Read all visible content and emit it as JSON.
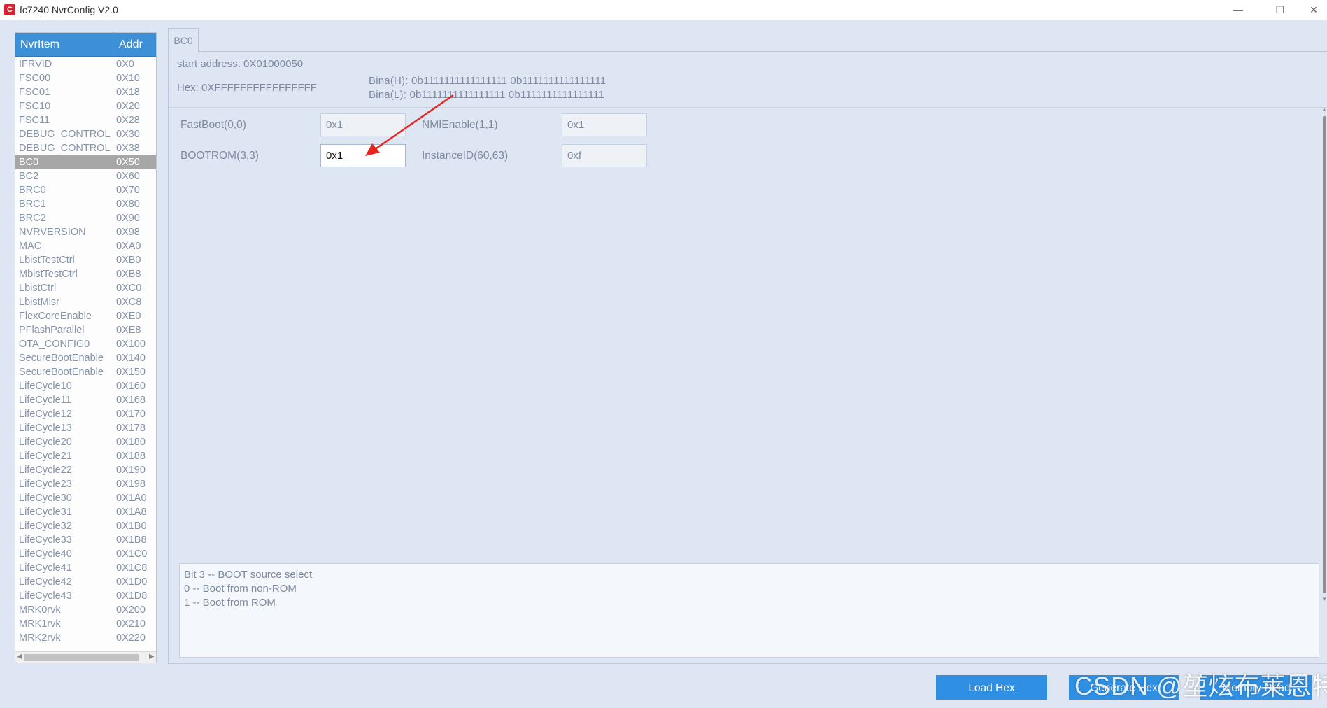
{
  "window": {
    "title": "fc7240 NvrConfig V2.0",
    "icon_text": "C",
    "min_glyph": "—",
    "max_glyph": "❐",
    "close_glyph": "✕"
  },
  "list": {
    "header_name": "NvrItem",
    "header_addr": "Addr",
    "items": [
      {
        "name": "IFRVID",
        "addr": "0X0"
      },
      {
        "name": "FSC00",
        "addr": "0X10"
      },
      {
        "name": "FSC01",
        "addr": "0X18"
      },
      {
        "name": "FSC10",
        "addr": "0X20"
      },
      {
        "name": "FSC11",
        "addr": "0X28"
      },
      {
        "name": "DEBUG_CONTROL",
        "addr": "0X30"
      },
      {
        "name": "DEBUG_CONTROL",
        "addr": "0X38"
      },
      {
        "name": "BC0",
        "addr": "0X50"
      },
      {
        "name": "BC2",
        "addr": "0X60"
      },
      {
        "name": "BRC0",
        "addr": "0X70"
      },
      {
        "name": "BRC1",
        "addr": "0X80"
      },
      {
        "name": "BRC2",
        "addr": "0X90"
      },
      {
        "name": "NVRVERSION",
        "addr": "0X98"
      },
      {
        "name": "MAC",
        "addr": "0XA0"
      },
      {
        "name": "LbistTestCtrl",
        "addr": "0XB0"
      },
      {
        "name": "MbistTestCtrl",
        "addr": "0XB8"
      },
      {
        "name": "LbistCtrl",
        "addr": "0XC0"
      },
      {
        "name": "LbistMisr",
        "addr": "0XC8"
      },
      {
        "name": "FlexCoreEnable",
        "addr": "0XE0"
      },
      {
        "name": "PFlashParallel",
        "addr": "0XE8"
      },
      {
        "name": "OTA_CONFIG0",
        "addr": "0X100"
      },
      {
        "name": "SecureBootEnable",
        "addr": "0X140"
      },
      {
        "name": "SecureBootEnable",
        "addr": "0X150"
      },
      {
        "name": "LifeCycle10",
        "addr": "0X160"
      },
      {
        "name": "LifeCycle11",
        "addr": "0X168"
      },
      {
        "name": "LifeCycle12",
        "addr": "0X170"
      },
      {
        "name": "LifeCycle13",
        "addr": "0X178"
      },
      {
        "name": "LifeCycle20",
        "addr": "0X180"
      },
      {
        "name": "LifeCycle21",
        "addr": "0X188"
      },
      {
        "name": "LifeCycle22",
        "addr": "0X190"
      },
      {
        "name": "LifeCycle23",
        "addr": "0X198"
      },
      {
        "name": "LifeCycle30",
        "addr": "0X1A0"
      },
      {
        "name": "LifeCycle31",
        "addr": "0X1A8"
      },
      {
        "name": "LifeCycle32",
        "addr": "0X1B0"
      },
      {
        "name": "LifeCycle33",
        "addr": "0X1B8"
      },
      {
        "name": "LifeCycle40",
        "addr": "0X1C0"
      },
      {
        "name": "LifeCycle41",
        "addr": "0X1C8"
      },
      {
        "name": "LifeCycle42",
        "addr": "0X1D0"
      },
      {
        "name": "LifeCycle43",
        "addr": "0X1D8"
      },
      {
        "name": "MRK0rvk",
        "addr": "0X200"
      },
      {
        "name": "MRK1rvk",
        "addr": "0X210"
      },
      {
        "name": "MRK2rvk",
        "addr": "0X220"
      }
    ],
    "selected_name": "BC0"
  },
  "tab": {
    "label": "BC0"
  },
  "details": {
    "start_address": "start address: 0X01000050",
    "hex": "Hex: 0XFFFFFFFFFFFFFFFF",
    "bina_h": "Bina(H): 0b1111111111111111 0b1111111111111111",
    "bina_l": "Bina(L): 0b1111111111111111 0b1111111111111111"
  },
  "fields": {
    "fastboot": {
      "label": "FastBoot(0,0)",
      "value": "0x1"
    },
    "nmienable": {
      "label": "NMIEnable(1,1)",
      "value": "0x1"
    },
    "bootrom": {
      "label": "BOOTROM(3,3)",
      "value": "0x1"
    },
    "instanceid": {
      "label": "InstanceID(60,63)",
      "value": "0xf"
    }
  },
  "description": {
    "lines": [
      "Bit 3 -- BOOT source select",
      "0 -- Boot from non-ROM",
      "1 -- Boot from ROM"
    ]
  },
  "buttons": {
    "load_hex": "Load Hex",
    "generate_hex": "Generate Hex",
    "memory_read": "Memory Read"
  },
  "watermark": "CSDN @堃炫布莱恩特",
  "colors": {
    "header_blue": "#3d8fd6",
    "button_blue": "#2f8fe3",
    "annotation_red": "#e8251f",
    "selected_row": "#a7a7a7"
  }
}
